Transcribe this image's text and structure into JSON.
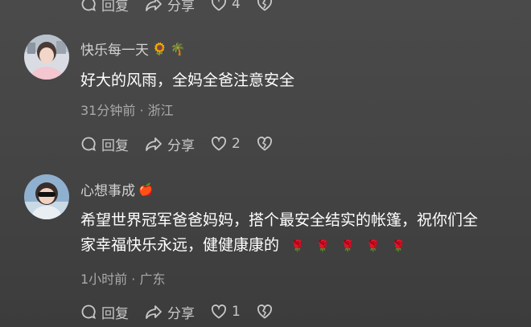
{
  "top_actions": {
    "reply": "回复",
    "share": "分享",
    "like_count": "4"
  },
  "comments": [
    {
      "username": "快乐每一天",
      "username_emojis": [
        "🌻",
        "🌴"
      ],
      "text": "好大的风雨，全妈全爸注意安全",
      "meta": "31分钟前 · 浙江",
      "reply": "回复",
      "share": "分享",
      "like_count": "2"
    },
    {
      "username": "心想事成",
      "username_emojis": [
        "🍎"
      ],
      "text_line1": "希望世界冠军爸爸妈妈，搭个最安全结实的帐篷，祝你们全",
      "text_line2": "家幸福快乐永远，健健康康的",
      "trailing_emojis": [
        "🌹",
        "🌹",
        "🌹",
        "🌹",
        "🌹"
      ],
      "meta": "1小时前 · 广东",
      "reply": "回复",
      "share": "分享",
      "like_count": "1"
    }
  ],
  "colors": {
    "background": "#484848",
    "text": "#ffffff",
    "secondary": "#a9a9a9",
    "icon": "#c8c8c8"
  }
}
